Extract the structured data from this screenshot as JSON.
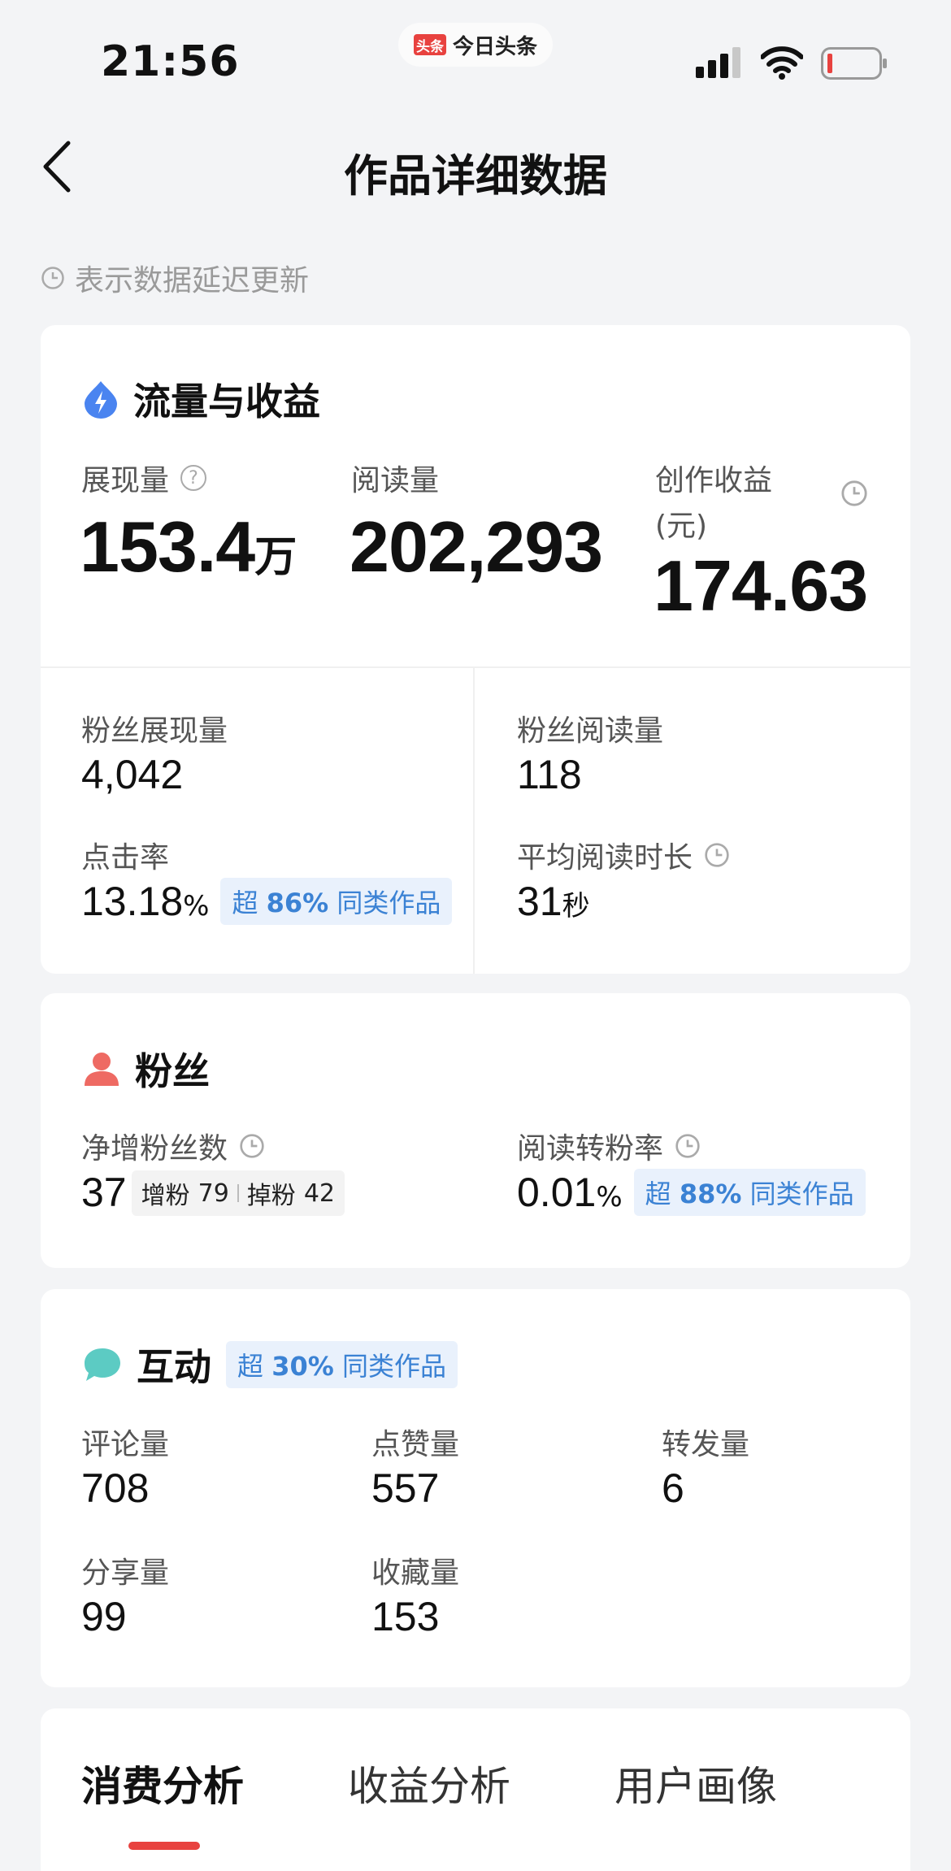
{
  "status_bar": {
    "time": "21:56",
    "app_logo": "头条",
    "app_name": "今日头条"
  },
  "header": {
    "title": "作品详细数据"
  },
  "notice": "表示数据延迟更新",
  "traffic": {
    "title": "流量与收益",
    "impressions": {
      "label": "展现量",
      "value": "153.4",
      "unit": "万"
    },
    "reads": {
      "label": "阅读量",
      "value": "202,293"
    },
    "earnings": {
      "label": "创作收益",
      "label2": "(元)",
      "value": "174.63"
    },
    "fan_impressions": {
      "label": "粉丝展现量",
      "value": "4,042"
    },
    "fan_reads": {
      "label": "粉丝阅读量",
      "value": "118"
    },
    "ctr": {
      "label": "点击率",
      "value": "13.18",
      "unit": "%",
      "badge_prefix": "超",
      "badge_pct": "86%",
      "badge_suffix": "同类作品"
    },
    "avg_read": {
      "label": "平均阅读时长",
      "value": "31",
      "unit": "秒"
    }
  },
  "fans": {
    "title": "粉丝",
    "net": {
      "label": "净增粉丝数",
      "value": "37",
      "gain_label": "增粉",
      "gain": "79",
      "loss_label": "掉粉",
      "loss": "42"
    },
    "conv": {
      "label": "阅读转粉率",
      "value": "0.01",
      "unit": "%",
      "badge_prefix": "超",
      "badge_pct": "88%",
      "badge_suffix": "同类作品"
    }
  },
  "interaction": {
    "title": "互动",
    "badge_prefix": "超",
    "badge_pct": "30%",
    "badge_suffix": "同类作品",
    "comments": {
      "label": "评论量",
      "value": "708"
    },
    "likes": {
      "label": "点赞量",
      "value": "557"
    },
    "reposts": {
      "label": "转发量",
      "value": "6"
    },
    "shares": {
      "label": "分享量",
      "value": "99"
    },
    "favorites": {
      "label": "收藏量",
      "value": "153"
    }
  },
  "tabs": [
    "消费分析",
    "收益分析",
    "用户画像"
  ],
  "colors": {
    "accent_red": "#e8423f",
    "badge_blue": "#3b82d4",
    "icon_blue": "#4a84f0",
    "icon_red": "#ee6a63",
    "icon_teal": "#5ccbc3"
  }
}
